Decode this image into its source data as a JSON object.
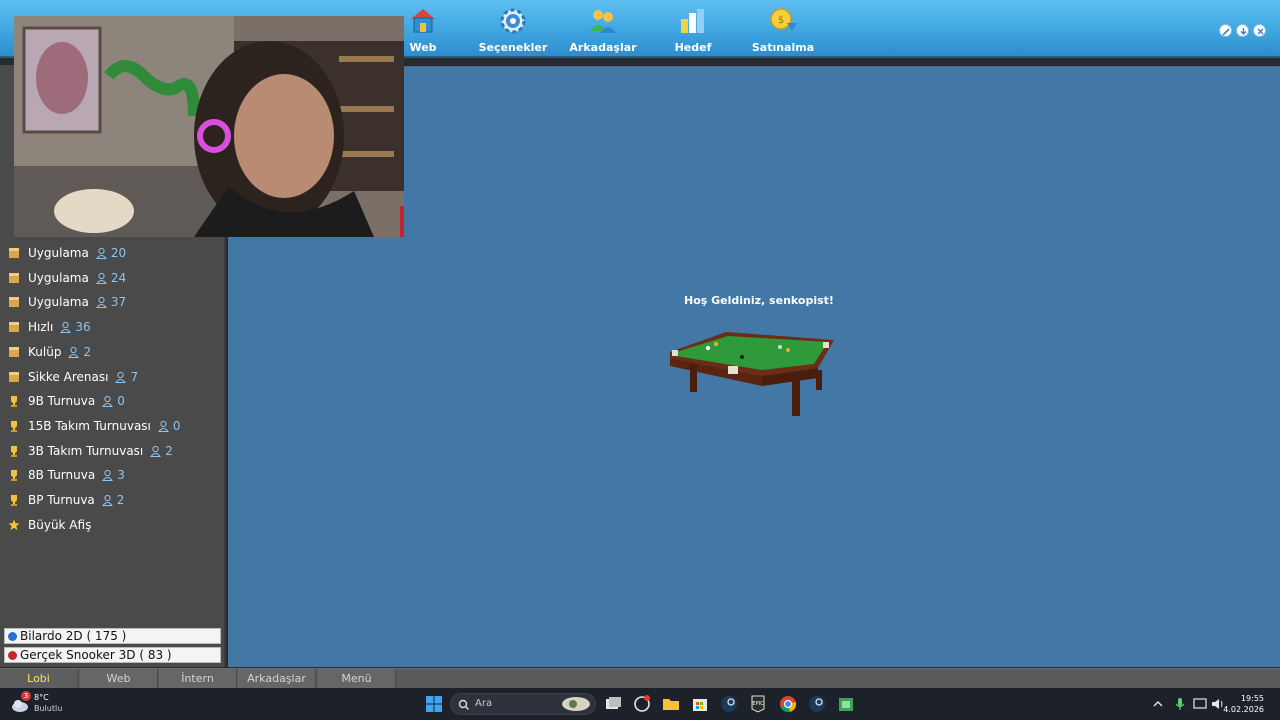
{
  "toolbar": {
    "items": [
      {
        "label": "Web",
        "icon": "web-house-icon"
      },
      {
        "label": "Seçenekler",
        "icon": "gear-icon"
      },
      {
        "label": "Arkadaşlar",
        "icon": "friends-icon"
      },
      {
        "label": "Hedef",
        "icon": "bar-chart-icon"
      },
      {
        "label": "Satınalma",
        "icon": "coins-icon"
      }
    ]
  },
  "sidebar": {
    "items": [
      {
        "label": "Uygulama",
        "count": "20",
        "icon": "box-icon"
      },
      {
        "label": "Uygulama",
        "count": "24",
        "icon": "box-icon"
      },
      {
        "label": "Uygulama",
        "count": "37",
        "icon": "box-icon"
      },
      {
        "label": "Hızlı",
        "count": "36",
        "icon": "box-icon"
      },
      {
        "label": "Kulüp",
        "count": "2",
        "icon": "box-icon"
      },
      {
        "label": "Sikke Arenası",
        "count": "7",
        "icon": "box-icon"
      },
      {
        "label": "9B Turnuva",
        "count": "0",
        "icon": "trophy-icon"
      },
      {
        "label": "15B Takım Turnuvası",
        "count": "0",
        "icon": "trophy-icon"
      },
      {
        "label": "3B Takım Turnuvası",
        "count": "2",
        "icon": "trophy-icon"
      },
      {
        "label": "8B Turnuva",
        "count": "3",
        "icon": "trophy-icon"
      },
      {
        "label": "BP Turnuva",
        "count": "2",
        "icon": "trophy-icon"
      },
      {
        "label": "Büyük Afiş",
        "count": "",
        "icon": "star-icon"
      }
    ],
    "games": [
      {
        "label": "Bilardo 2D  ( 175 )",
        "color": "#2a6fd0"
      },
      {
        "label": "Gerçek Snooker 3D  ( 83 )",
        "color": "#c62828"
      }
    ]
  },
  "main": {
    "welcome": "Hoş Geldiniz, senkopist!"
  },
  "bottom_tabs": [
    {
      "label": "Lobi",
      "active": true
    },
    {
      "label": "Web",
      "active": false
    },
    {
      "label": "İntern",
      "active": false
    },
    {
      "label": "Arkadaşlar",
      "active": false
    },
    {
      "label": "Menü",
      "active": false
    }
  ],
  "taskbar": {
    "weather_temp": "8°C",
    "weather_cond": "Bulutlu",
    "weather_badge": "3",
    "search_placeholder": "Ara",
    "time": "19:55",
    "date": "4.02.2026"
  },
  "colors": {
    "toolbar": "#3fa6e0",
    "main_bg": "#4277a6",
    "sidebar_bg": "#4a4a4a",
    "count": "#8fc4ee",
    "active_tab": "#f2e85a"
  }
}
